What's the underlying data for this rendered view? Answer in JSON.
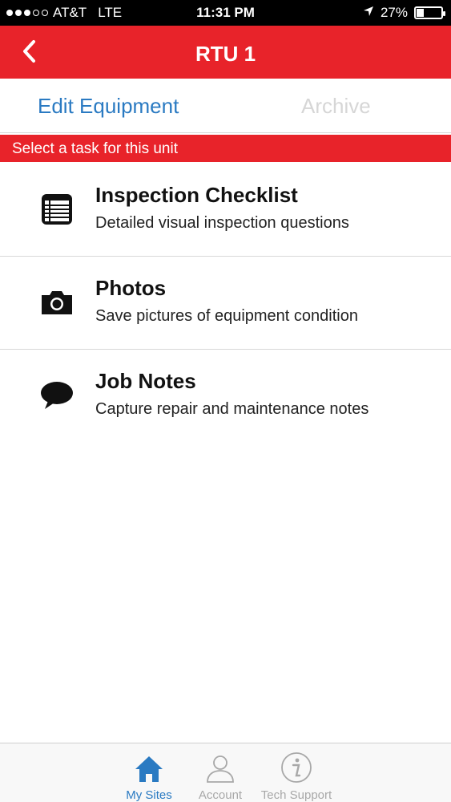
{
  "status_bar": {
    "carrier": "AT&T",
    "network": "LTE",
    "time": "11:31 PM",
    "battery": "27%",
    "battery_level": 0.27,
    "signal_bars_filled": 3,
    "signal_bars_total": 5
  },
  "nav": {
    "title": "RTU 1",
    "back_icon": "chevron-left-icon"
  },
  "actions": {
    "edit": "Edit Equipment",
    "archive": "Archive"
  },
  "section": {
    "banner": "Select a task for this unit"
  },
  "tasks": [
    {
      "title": "Inspection Checklist",
      "subtitle": "Detailed visual inspection questions",
      "icon": "checklist-icon"
    },
    {
      "title": "Photos",
      "subtitle": "Save pictures of equipment condition",
      "icon": "camera-icon"
    },
    {
      "title": "Job Notes",
      "subtitle": "Capture repair and maintenance notes",
      "icon": "speech-bubble-icon"
    }
  ],
  "tab_bar": {
    "tabs": [
      {
        "label": "My Sites",
        "icon": "home-icon",
        "active": true
      },
      {
        "label": "Account",
        "icon": "user-icon",
        "active": false
      },
      {
        "label": "Tech Support",
        "icon": "info-icon",
        "active": false
      }
    ]
  },
  "colors": {
    "brand_red": "#e8232a",
    "link_blue": "#2a7ac2",
    "disabled_gray": "#d6d6d6"
  }
}
